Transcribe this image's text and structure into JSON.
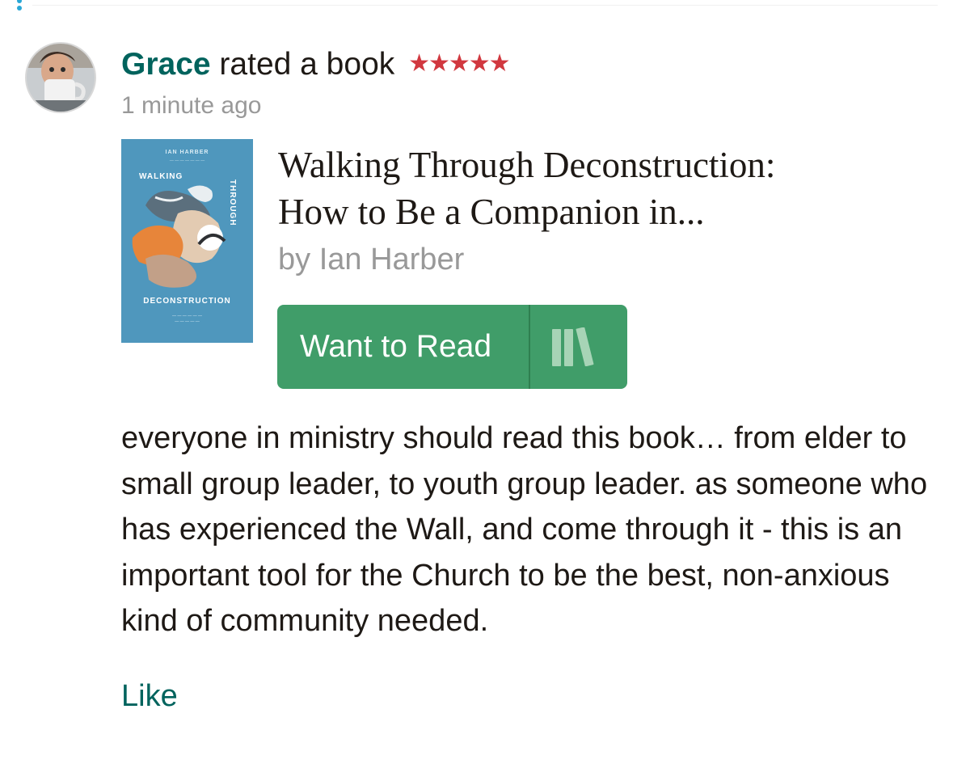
{
  "update": {
    "user_name": "Grace",
    "action": " rated a book ",
    "rating": 5,
    "stars_text": "★★★★★",
    "timestamp": "1 minute ago",
    "colors": {
      "user_name": "#00635d",
      "stars": "#d1383f",
      "muted_text": "#999999",
      "button": "#409d69",
      "cover": "#4f97bd"
    }
  },
  "book": {
    "title_line1": "Walking Through Deconstruction:",
    "title_line2": "How to Be a Companion in...",
    "author": "by Ian Harber",
    "cover": {
      "author_text": "IAN HARBER",
      "word_top": "WALKING",
      "word_side": "THROUGH",
      "word_bottom": "DECONSTRUCTION"
    }
  },
  "shelf_button": {
    "label": "Want to Read",
    "icon": "bookshelf-icon"
  },
  "review": {
    "text": "everyone in ministry should read this book… from elder to small group leader, to youth group leader. as someone who has experienced the Wall, and come through it - this is an important tool for the Church to be the best, non-anxious kind of community needed."
  },
  "actions": {
    "like_label": "Like"
  }
}
